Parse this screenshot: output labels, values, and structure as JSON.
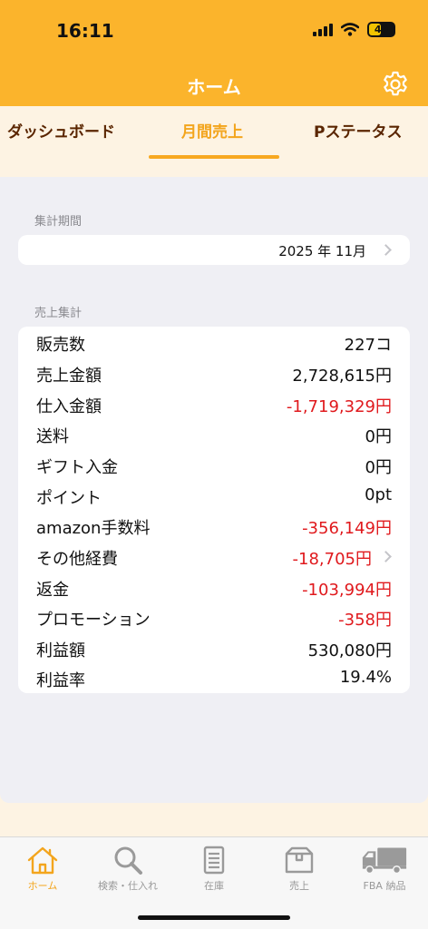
{
  "status_bar": {
    "time": "16:11",
    "battery": "49"
  },
  "header": {
    "title": "ホーム"
  },
  "tabs": [
    {
      "label": "ダッシュボード",
      "active": false
    },
    {
      "label": "月間売上",
      "active": true
    },
    {
      "label": "Pステータス",
      "active": false
    }
  ],
  "period": {
    "section_label": "集計期間",
    "value": "2025 年 11月"
  },
  "summary": {
    "section_label": "売上集計",
    "rows": [
      {
        "label": "販売数",
        "value": "227コ"
      },
      {
        "label": "売上金額",
        "value": "2,728,615円"
      },
      {
        "label": "仕入金額",
        "value": "-1,719,329円"
      },
      {
        "label": "送料",
        "value": "0円"
      },
      {
        "label": "ギフト入金",
        "value": "0円"
      },
      {
        "label": "ポイント",
        "value": "0pt"
      },
      {
        "label": "amazon手数料",
        "value": "-356,149円"
      },
      {
        "label": "その他経費",
        "value": "-18,705円"
      },
      {
        "label": "返金",
        "value": "-103,994円"
      },
      {
        "label": "プロモーション",
        "value": "-358円"
      },
      {
        "label": "利益額",
        "value": "530,080円"
      },
      {
        "label": "利益率",
        "value": "19.4%"
      }
    ]
  },
  "tabbar": [
    {
      "label": "ホーム",
      "icon": "home-icon",
      "active": true
    },
    {
      "label": "検索・仕入れ",
      "icon": "search-icon",
      "active": false
    },
    {
      "label": "在庫",
      "icon": "clipboard-icon",
      "active": false
    },
    {
      "label": "売上",
      "icon": "box-icon",
      "active": false
    },
    {
      "label": "FBA 納品",
      "icon": "truck-icon",
      "active": false
    }
  ],
  "colors": {
    "accent": "#fbb42c",
    "tab_active": "#f3a51d",
    "tab_inactive": "#5a2500",
    "negative": "#e0191d"
  }
}
